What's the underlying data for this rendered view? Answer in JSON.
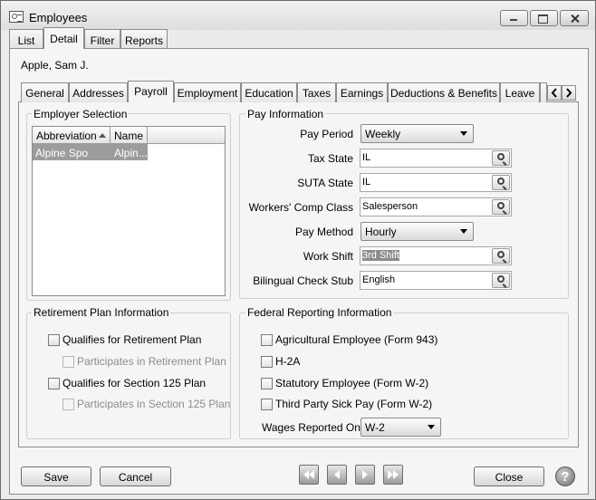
{
  "window": {
    "title": "Employees"
  },
  "top_tabs": [
    "List",
    "Detail",
    "Filter",
    "Reports"
  ],
  "employee_name": "Apple, Sam J.",
  "inner_tabs": [
    "General",
    "Addresses",
    "Payroll",
    "Employment",
    "Education",
    "Taxes",
    "Earnings",
    "Deductions & Benefits",
    "Leave"
  ],
  "employer_selection": {
    "label": "Employer Selection",
    "columns": [
      "Abbreviation",
      "Name"
    ],
    "rows": [
      {
        "abbreviation": "Alpine Spo",
        "name": "Alpin..."
      }
    ]
  },
  "pay_info": {
    "label": "Pay Information",
    "pay_period": {
      "label": "Pay Period",
      "value": "Weekly"
    },
    "tax_state": {
      "label": "Tax State",
      "value": "IL"
    },
    "suta_state": {
      "label": "SUTA State",
      "value": "IL"
    },
    "workers_comp": {
      "label": "Workers' Comp Class",
      "value": "Salesperson"
    },
    "pay_method": {
      "label": "Pay Method",
      "value": "Hourly"
    },
    "work_shift": {
      "label": "Work Shift",
      "value": "3rd Shift"
    },
    "bilingual": {
      "label": "Bilingual Check Stub",
      "value": "English"
    }
  },
  "retirement": {
    "label": "Retirement Plan Information",
    "qualifies_retirement": "Qualifies for Retirement Plan",
    "participates_retirement": "Participates in Retirement Plan",
    "qualifies_125": "Qualifies for Section 125 Plan",
    "participates_125": "Participates in Section 125 Plan"
  },
  "federal": {
    "label": "Federal Reporting Information",
    "agricultural": "Agricultural Employee (Form 943)",
    "h2a": "H-2A",
    "statutory": "Statutory Employee (Form W-2)",
    "third_party": "Third Party Sick Pay (Form W-2)",
    "wages_label": "Wages Reported On",
    "wages_value": "W-2"
  },
  "buttons": {
    "save": "Save",
    "cancel": "Cancel",
    "close": "Close",
    "help": "?"
  }
}
